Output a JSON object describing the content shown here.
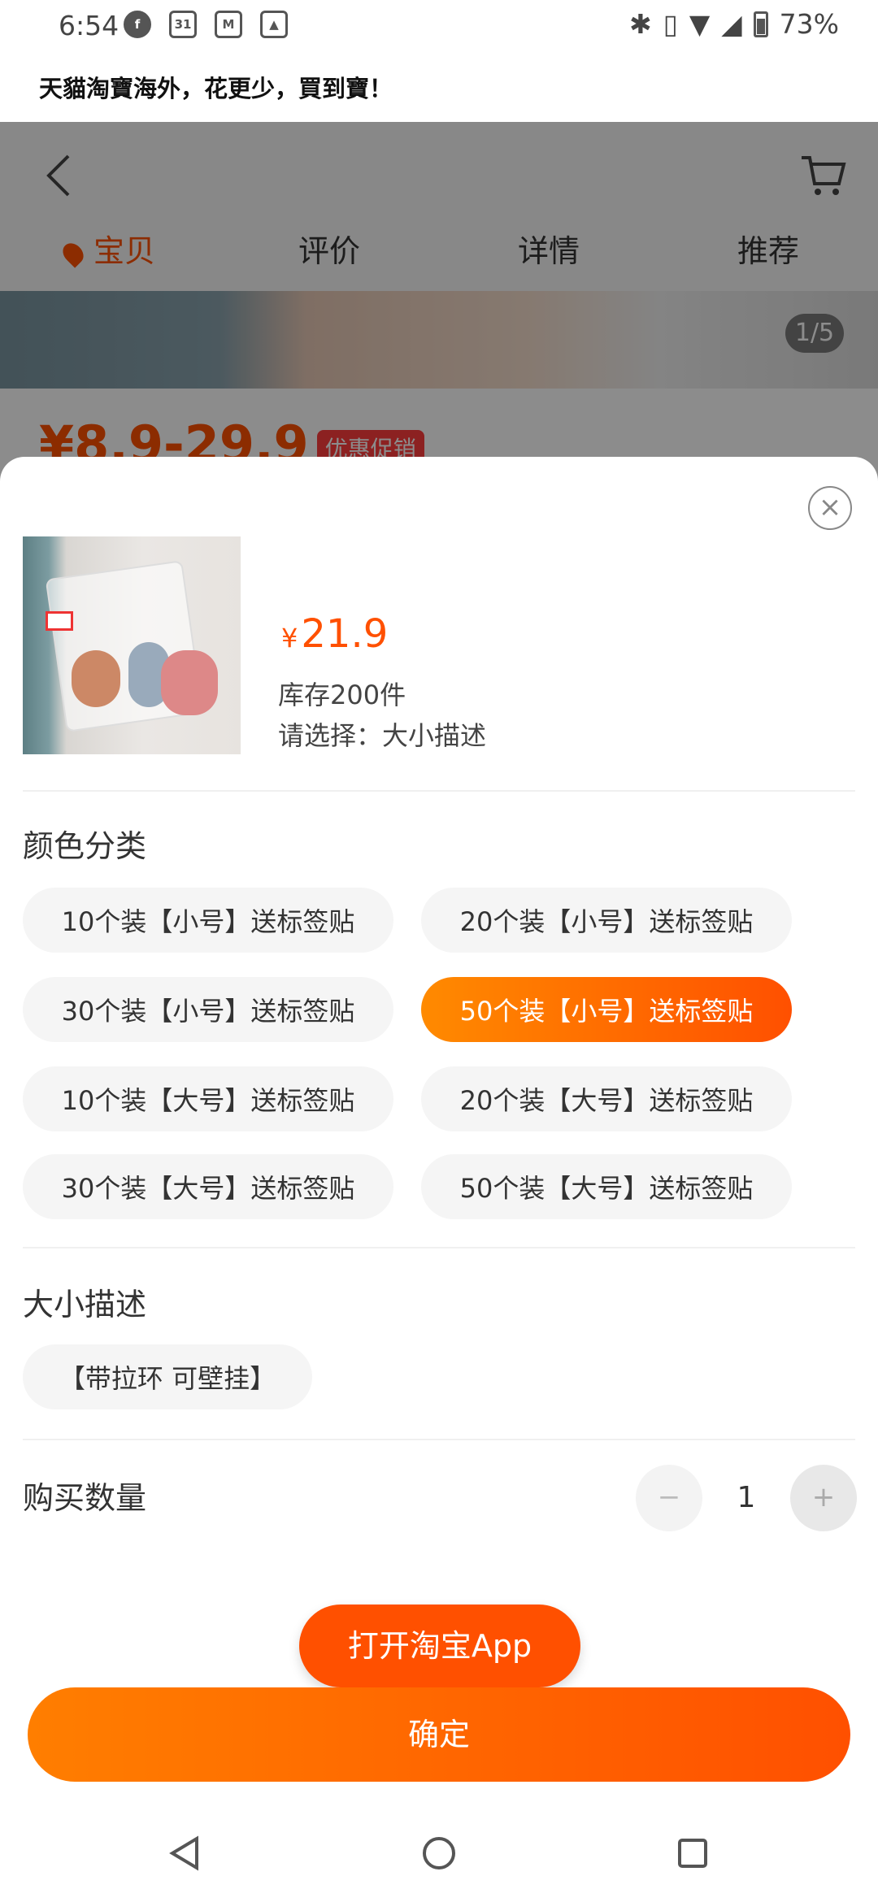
{
  "status_bar": {
    "time": "6:54",
    "calendar_day": "31",
    "battery_percent": "73%"
  },
  "banner": {
    "text": "天貓淘寶海外，花更少，買到寶！"
  },
  "nav_tabs": [
    {
      "label": "宝贝"
    },
    {
      "label": "评价"
    },
    {
      "label": "详情"
    },
    {
      "label": "推荐"
    }
  ],
  "gallery": {
    "counter": "1/5"
  },
  "behind": {
    "price_range": "¥8.9-29.9",
    "promo": "优惠促销"
  },
  "sheet": {
    "currency": "¥",
    "price": "21.9",
    "stock": "库存200件",
    "prompt": "请选择：大小描述",
    "color_section": "颜色分类",
    "color_options": [
      {
        "label": "10个装【小号】送标签贴",
        "selected": false
      },
      {
        "label": "20个装【小号】送标签贴",
        "selected": false
      },
      {
        "label": "30个装【小号】送标签贴",
        "selected": false
      },
      {
        "label": "50个装【小号】送标签贴",
        "selected": true
      },
      {
        "label": "10个装【大号】送标签贴",
        "selected": false
      },
      {
        "label": "20个装【大号】送标签贴",
        "selected": false
      },
      {
        "label": "30个装【大号】送标签贴",
        "selected": false
      },
      {
        "label": "50个装【大号】送标签贴",
        "selected": false
      }
    ],
    "size_section": "大小描述",
    "size_options": [
      {
        "label": "【带拉环 可壁挂】"
      }
    ],
    "quantity_label": "购买数量",
    "quantity_value": "1",
    "minus": "−",
    "plus": "+",
    "close": "×"
  },
  "buttons": {
    "open_app": "打开淘宝App",
    "confirm": "确定"
  },
  "colors": {
    "accent": "#ff5000",
    "accent_light": "#ff8a00"
  }
}
